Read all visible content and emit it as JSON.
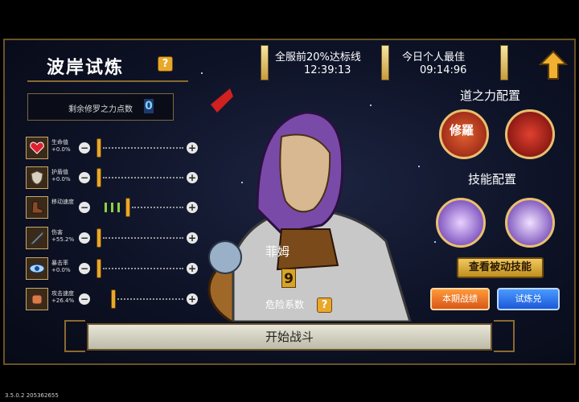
{
  "header": {
    "title": "波岸试炼",
    "server_line_label": "全服前20%达标线",
    "server_line_time": "12:39:13",
    "personal_best_label": "今日个人最佳",
    "personal_best_time": "09:14:96"
  },
  "points": {
    "label": "剩余修罗之力点数",
    "value": "0"
  },
  "stats": [
    {
      "name": "生命值",
      "value": "+0.0%",
      "icon": "heart-icon",
      "level": 0
    },
    {
      "name": "护盾值",
      "value": "+0.0%",
      "icon": "shield-icon",
      "level": 0
    },
    {
      "name": "移动速度",
      "value": "",
      "icon": "boot-icon",
      "level": 3
    },
    {
      "name": "伤害",
      "value": "+55.2%",
      "icon": "sword-icon",
      "level": 0
    },
    {
      "name": "暴击率",
      "value": "+0.0%",
      "icon": "eye-icon",
      "level": 0
    },
    {
      "name": "攻击速度",
      "value": "+26.4%",
      "icon": "fist-icon",
      "level": 0
    }
  ],
  "hero": {
    "name": "菲姆",
    "level": "9",
    "danger_label": "危险系数"
  },
  "dao_section": {
    "title": "道之力配置",
    "slots": [
      {
        "glyph": "修羅",
        "icon": "shura-rune-icon"
      },
      {
        "glyph": "",
        "icon": "red-portrait-icon"
      }
    ]
  },
  "skill_section": {
    "title": "技能配置",
    "slots": [
      {
        "icon": "purple-slash-skill-icon"
      },
      {
        "icon": "purple-vortex-skill-icon"
      }
    ],
    "view_passive_label": "查看被动技能"
  },
  "buttons": {
    "season_battle": "本期战绩",
    "trial_exchange": "试炼兑",
    "start_battle": "开始战斗"
  },
  "version": "3.5.0.2 205362655",
  "colors": {
    "panel_border": "#6a5226",
    "accent_gold": "#e8a82a",
    "orange": "#d8561a",
    "blue": "#1c58d8"
  }
}
